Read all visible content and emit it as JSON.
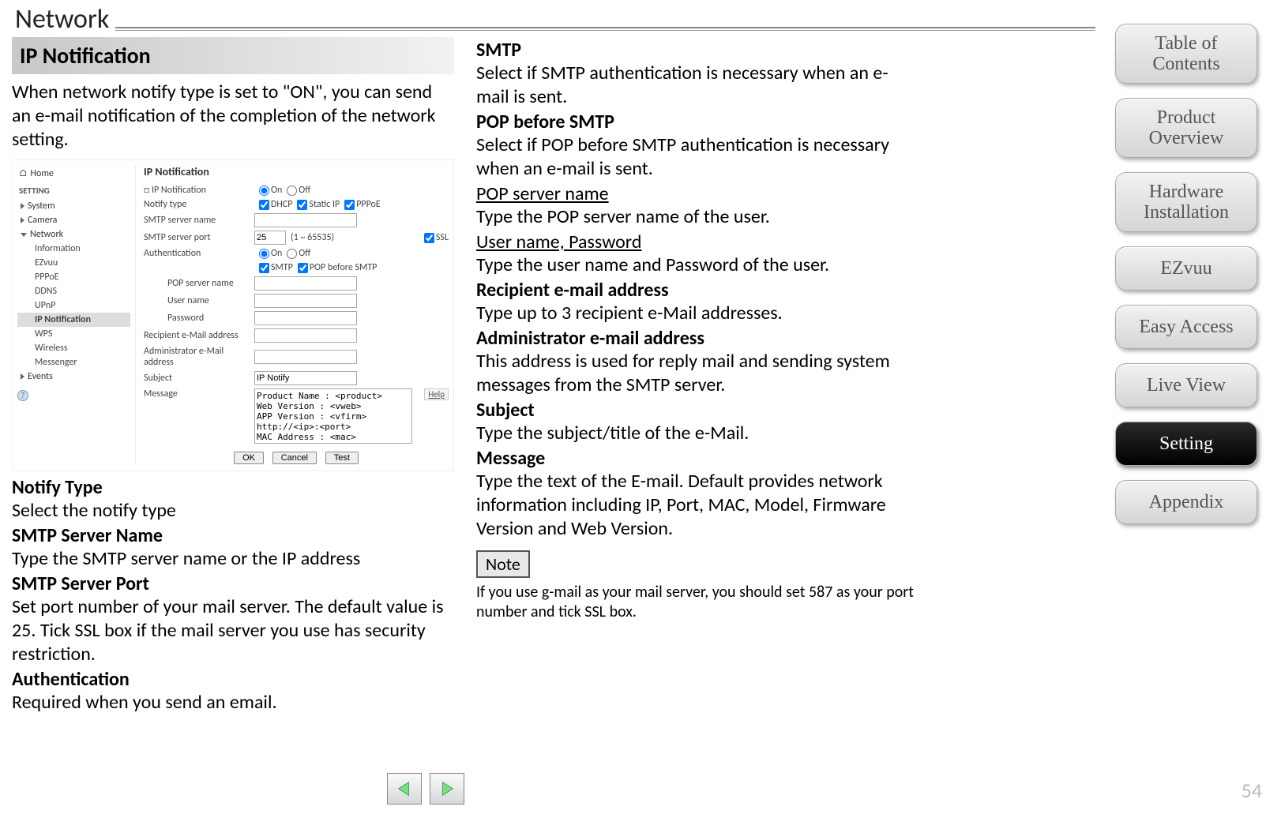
{
  "page": {
    "title": "Network",
    "number": "54",
    "section_heading": "IP Notification",
    "intro": "When network notify type is set to \"ON\", you can send an e-mail notification of the completion of the network setting."
  },
  "settings_panel": {
    "home_label": "Home",
    "setting_label": "SETTING",
    "nav": {
      "system": "System",
      "camera": "Camera",
      "network": "Network",
      "events": "Events"
    },
    "subs": {
      "info": "Information",
      "ezvuu": "EZvuu",
      "pppoe": "PPPoE",
      "ddns": "DDNS",
      "upnp": "UPnP",
      "ipnotif": "IP Notification",
      "wps": "WPS",
      "wireless": "Wireless",
      "messenger": "Messenger"
    },
    "form_title": "IP Notification",
    "labels": {
      "ip_notification": "IP Notification",
      "on": "On",
      "off": "Off",
      "notify_type": "Notify type",
      "dhcp": "DHCP",
      "static_ip": "Static IP",
      "pppoe": "PPPoE",
      "smtp_name": "SMTP server name",
      "smtp_port": "SMTP server port",
      "port_value": "25",
      "port_range": "(1 ~ 65535)",
      "ssl": "SSL",
      "auth": "Authentication",
      "smtp": "SMTP",
      "pop_b4": "POP before SMTP",
      "pop_server": "POP server name",
      "user": "User name",
      "pass": "Password",
      "recip": "Recipient e-Mail address",
      "admin": "Administrator e-Mail address",
      "subject": "Subject",
      "subject_val": "IP Notify",
      "message": "Message",
      "message_val": "Product Name : <product>\nWeb Version : <vweb>\nAPP Version : <vfirm>\nhttp://<ip>:<port>\nMAC Address : <mac>"
    },
    "buttons": {
      "ok": "OK",
      "cancel": "Cancel",
      "test": "Test",
      "help": "Help"
    }
  },
  "col1_terms": {
    "notify_type": {
      "t": "Notify Type",
      "d": "Select the notify type"
    },
    "smtp_name": {
      "t": "SMTP Server Name",
      "d": "Type the SMTP server name or the IP address"
    },
    "smtp_port": {
      "t": "SMTP Server Port",
      "d": "Set port number of your mail server. The default value is 25. Tick SSL box if the mail server you use has security restriction."
    },
    "auth": {
      "t": "Authentication",
      "d": "Required when you send an email."
    }
  },
  "col2_terms": {
    "smtp": {
      "t": "SMTP",
      "d": "Select if SMTP authentication is necessary when an e-mail is sent."
    },
    "pop_b4": {
      "t": "POP before SMTP",
      "d": "Select if POP before SMTP authentication is necessary when an e-mail is sent."
    },
    "pop_server": {
      "t": "POP server name",
      "d": "Type the POP server name of the user."
    },
    "user_pw": {
      "t": "User name, Password",
      "d": "Type the user name and Password of the user."
    },
    "recip": {
      "t": "Recipient e-mail address",
      "d": "Type up to 3 recipient e-Mail addresses."
    },
    "admin": {
      "t": "Administrator e-mail address",
      "d": "This address is used for reply mail and sending system messages from the SMTP server."
    },
    "subject": {
      "t": "Subject",
      "d": "Type the subject/title of the e-Mail."
    },
    "message": {
      "t": "Message",
      "d": "Type the text of the E-mail. Default  provides network information including IP, Port, MAC, Model, Firmware Version and Web Version."
    }
  },
  "note": {
    "label": "Note",
    "text": "If you use g-mail as your mail server, you should set 587 as your port number and tick SSL box."
  },
  "sidebar": {
    "toc": "Table of Contents",
    "product": "Product Overview",
    "hardware": "Hardware Installation",
    "ezvuu": "EZvuu",
    "easy": "Easy Access",
    "live": "Live View",
    "setting": "Setting",
    "appendix": "Appendix"
  }
}
